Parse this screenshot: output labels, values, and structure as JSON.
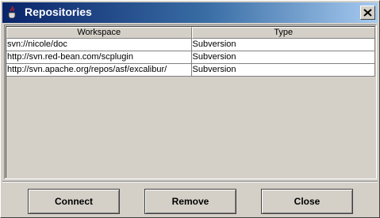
{
  "window": {
    "title": "Repositories",
    "title_icon": "java-cup-icon",
    "close_icon": "close-x-icon"
  },
  "table": {
    "columns": [
      "Workspace",
      "Type"
    ],
    "rows": [
      [
        "svn://nicole/doc",
        "Subversion"
      ],
      [
        "http://svn.red-bean.com/scplugin",
        "Subversion"
      ],
      [
        "http://svn.apache.org/repos/asf/excalibur/",
        "Subversion"
      ]
    ]
  },
  "buttons": {
    "connect": "Connect",
    "remove": "Remove",
    "close": "Close"
  }
}
